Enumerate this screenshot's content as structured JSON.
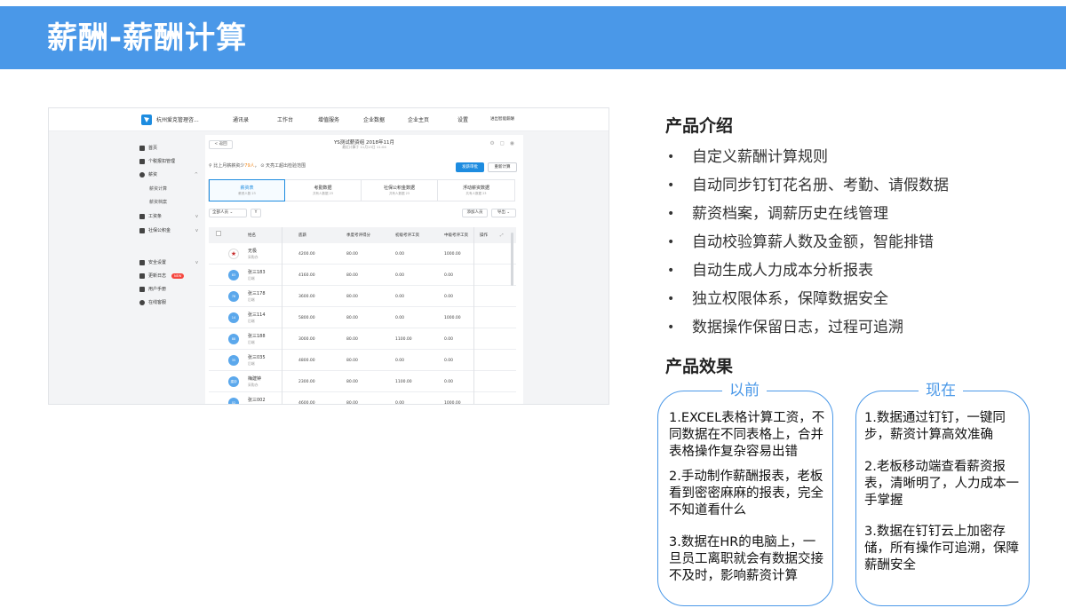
{
  "banner": {
    "title": "薪酬-薪酬计算"
  },
  "screenshot": {
    "company": "杭州爱克管理咨...",
    "nav": [
      "通讯录",
      "工作台",
      "增值服务",
      "企业数据",
      "企业主页",
      "设置"
    ],
    "nav_link": "进出智能薪酬",
    "sidebar": [
      {
        "label": "首页",
        "icon": "home-icon"
      },
      {
        "label": "个税报扣管理",
        "icon": "card-icon"
      },
      {
        "label": "薪资",
        "icon": "money-icon",
        "arrow": "^"
      },
      {
        "label": "薪资计算",
        "sub": true
      },
      {
        "label": "薪资档案",
        "sub": true
      },
      {
        "label": "工资条",
        "icon": "doc-icon",
        "arrow": "v"
      },
      {
        "label": "社保公积金",
        "icon": "shield-icon",
        "arrow": "v"
      },
      {
        "label": "安全设置",
        "icon": "users-icon",
        "arrow": "v"
      },
      {
        "label": "更新日志",
        "icon": "bell-icon",
        "badge": "NEW"
      },
      {
        "label": "用户手册",
        "icon": "book-icon"
      },
      {
        "label": "在线客服",
        "icon": "chat-icon"
      }
    ],
    "back": "< 返回",
    "title": "YS测试薪资组 2018年11月",
    "subtitle": "最近计算于 11月13日 11:04",
    "notice_prefix": "比上月薪薪资少",
    "notice_highlight": "79人",
    "notice_suffix": "天亮工超出检验范围",
    "btn_primary": "发薪审批",
    "btn_secondary": "重新计算",
    "tabs": [
      {
        "title": "薪资表",
        "sub": "薪资人数 23",
        "active": true
      },
      {
        "title": "考勤数据",
        "sub": "共有人数据 23"
      },
      {
        "title": "社保公积金数据",
        "sub": "共有人数据 23"
      },
      {
        "title": "浮动薪资数据",
        "sub": "共有人数据 23"
      }
    ],
    "filter": "全部人员",
    "filter_icon": "Y",
    "btn_add": "添加人员",
    "btn_export": "导出",
    "columns": [
      "姓名",
      "底薪",
      "季度考评得分",
      "初级考评工资",
      "中级考评工资",
      "操作"
    ],
    "rows": [
      {
        "avatar": "★",
        "name": "无极",
        "dept": "采购办",
        "c1": "4200.00",
        "c2": "80.00",
        "c3": "0.00",
        "c4": "1000.00"
      },
      {
        "avatar": "83",
        "name": "张三183",
        "dept": "后端",
        "c1": "4160.00",
        "c2": "80.00",
        "c3": "0.00",
        "c4": "0.00"
      },
      {
        "avatar": "78",
        "name": "张三178",
        "dept": "后端",
        "c1": "3600.00",
        "c2": "80.00",
        "c3": "0.00",
        "c4": "0.00"
      },
      {
        "avatar": "14",
        "name": "张三114",
        "dept": "后端",
        "c1": "5800.00",
        "c2": "80.00",
        "c3": "0.00",
        "c4": "1000.00"
      },
      {
        "avatar": "88",
        "name": "张三188",
        "dept": "后端",
        "c1": "3000.00",
        "c2": "80.00",
        "c3": "1100.00",
        "c4": "0.00"
      },
      {
        "avatar": "35",
        "name": "张三035",
        "dept": "后端",
        "c1": "4800.00",
        "c2": "80.00",
        "c3": "0.00",
        "c4": "0.00"
      },
      {
        "avatar": "建钟",
        "name": "梅建钟",
        "dept": "采购办",
        "c1": "2300.00",
        "c2": "80.00",
        "c3": "1100.00",
        "c4": "0.00"
      },
      {
        "avatar": "02",
        "name": "张三002",
        "dept": "后端",
        "c1": "4600.00",
        "c2": "80.00",
        "c3": "0.00",
        "c4": "1000.00"
      }
    ]
  },
  "intro": {
    "heading": "产品介绍",
    "bullet": "•",
    "items": [
      "自定义薪酬计算规则",
      "自动同步钉钉花名册、考勤、请假数据",
      "薪资档案，调薪历史在线管理",
      "自动校验算薪人数及金额，智能排错",
      "自动生成人力成本分析报表",
      "独立权限体系，保障数据安全",
      "数据操作保留日志，过程可追溯"
    ]
  },
  "effect": {
    "heading": "产品效果",
    "before": {
      "title": "以前",
      "points": [
        "1.EXCEL表格计算工资，不同数据在不同表格上，合并表格操作复杂容易出错",
        "2.手动制作薪酬报表，老板看到密密麻麻的报表，完全不知道看什么",
        "3.数据在HR的电脑上，一旦员工离职就会有数据交接不及时，影响薪资计算"
      ]
    },
    "after": {
      "title": "现在",
      "points": [
        "1.数据通过钉钉，一键同步，薪资计算高效准确",
        "2.老板移动端查看薪资报表，清晰明了，人力成本一手掌握",
        "3.数据在钉钉云上加密存储，所有操作可追溯，保障薪酬安全"
      ]
    }
  }
}
